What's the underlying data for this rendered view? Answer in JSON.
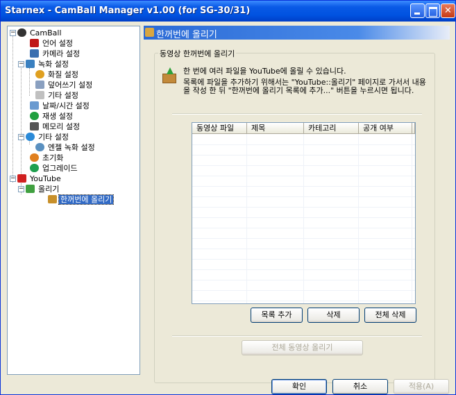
{
  "window": {
    "title": "Starnex - CamBall Manager v1.00 (for SG-30/31)"
  },
  "tree": [
    {
      "label": "CamBall",
      "icon": "camera-ball-icon",
      "color": "#333333"
    },
    {
      "label": "언어 설정",
      "icon": "language-icon",
      "color": "#c01818"
    },
    {
      "label": "카메라 설정",
      "icon": "camera-icon",
      "color": "#3a6fb0"
    },
    {
      "label": "녹화 설정",
      "icon": "record-icon",
      "color": "#3a80c0"
    },
    {
      "label": "화질 설정",
      "icon": "quality-icon",
      "color": "#e0a020"
    },
    {
      "label": "덮어쓰기 설정",
      "icon": "overwrite-icon",
      "color": "#8aa0c0"
    },
    {
      "label": "기타 설정",
      "icon": "misc-icon",
      "color": "#c0c0c0"
    },
    {
      "label": "날짜/시간 설정",
      "icon": "datetime-icon",
      "color": "#6a9ad0"
    },
    {
      "label": "재생 설정",
      "icon": "play-icon",
      "color": "#20a040"
    },
    {
      "label": "메모리 설정",
      "icon": "memory-icon",
      "color": "#555555"
    },
    {
      "label": "기타 설정",
      "icon": "settings-icon",
      "color": "#2a8ad8"
    },
    {
      "label": "엔젤 녹화 설정",
      "icon": "clock-icon",
      "color": "#5a90c0"
    },
    {
      "label": "초기화",
      "icon": "reset-icon",
      "color": "#e08020"
    },
    {
      "label": "업그레이드",
      "icon": "upgrade-icon",
      "color": "#20a050"
    },
    {
      "label": "YouTube",
      "icon": "youtube-icon",
      "color": "#d02020"
    },
    {
      "label": "올리기",
      "icon": "upload-icon",
      "color": "#40a040"
    },
    {
      "label": "한꺼번에 올리기",
      "icon": "batch-upload-icon",
      "color": "#c8902a"
    }
  ],
  "panel": {
    "header": "한꺼번에 올리기",
    "group_title": "동영상 한꺼번에 올리기",
    "info_line1": "한 번에 여러 파일을 YouTube에 올릴 수 있습니다.",
    "info_line2": "목록에 파일을 추가하기 위해서는 \"YouTube::올리기\" 페이지로 가서서 내용을 작성 한 뒤 \"한꺼번에 올리기 목록에 추가...\" 버튼을 누르시면 됩니다.",
    "columns": [
      "동영상 파일",
      "제목",
      "카테고리",
      "공개 여부"
    ],
    "add_button": "목록 추가",
    "delete_button": "삭제",
    "delete_all_button": "전체 삭제",
    "upload_all_button": "전체 동영상 올리기"
  },
  "footer": {
    "ok": "확인",
    "cancel": "취소",
    "apply": "적용(A)"
  }
}
